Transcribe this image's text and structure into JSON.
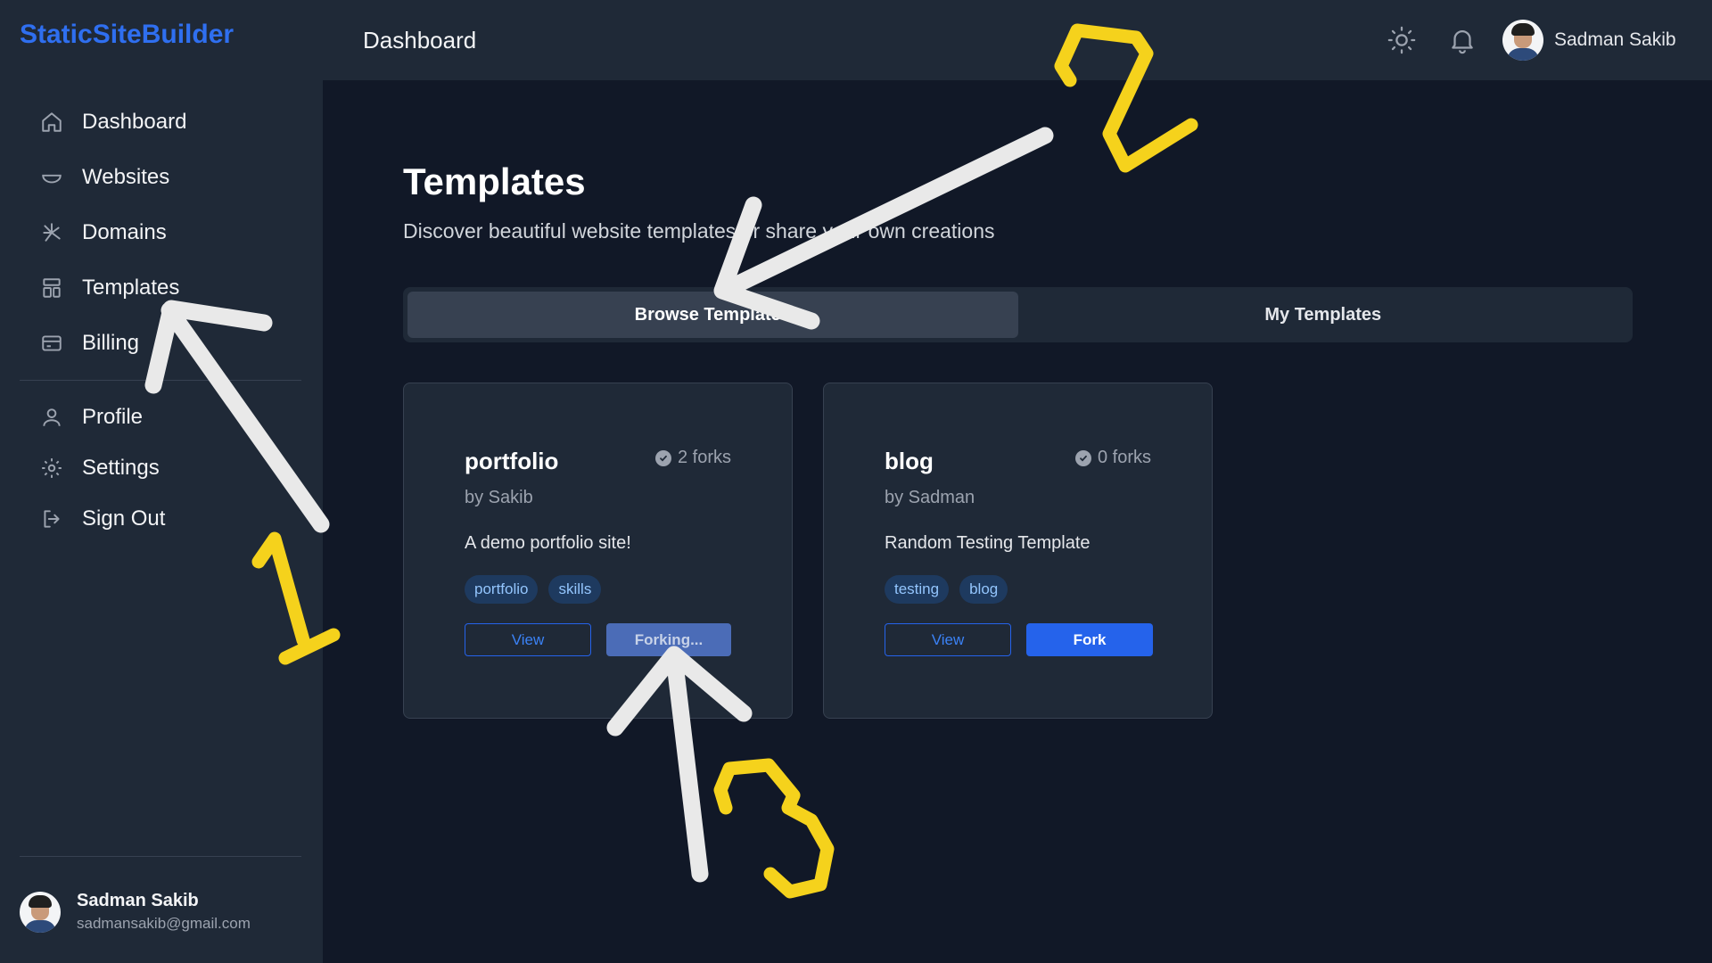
{
  "brand": "StaticSiteBuilder",
  "sidebar": {
    "items": [
      {
        "label": "Dashboard",
        "icon": "home-icon"
      },
      {
        "label": "Websites",
        "icon": "bowl-icon"
      },
      {
        "label": "Domains",
        "icon": "network-icon"
      },
      {
        "label": "Templates",
        "icon": "layout-icon"
      },
      {
        "label": "Billing",
        "icon": "credit-card-icon"
      }
    ],
    "items2": [
      {
        "label": "Profile",
        "icon": "user-icon"
      },
      {
        "label": "Settings",
        "icon": "gear-icon"
      },
      {
        "label": "Sign Out",
        "icon": "sign-out-icon"
      }
    ],
    "user": {
      "name": "Sadman Sakib",
      "email": "sadmansakib@gmail.com"
    }
  },
  "header": {
    "title": "Dashboard",
    "user_name": "Sadman Sakib",
    "icons": [
      "sun-icon",
      "bell-icon"
    ]
  },
  "main": {
    "title": "Templates",
    "subtitle": "Discover beautiful website templates or share your own creations",
    "tabs": [
      {
        "label": "Browse Templates",
        "active": true
      },
      {
        "label": "My Templates",
        "active": false
      }
    ],
    "cards": [
      {
        "title": "portfolio",
        "forks": "2 forks",
        "author": "by Sakib",
        "description": "A demo portfolio site!",
        "tags": [
          "portfolio",
          "skills"
        ],
        "view_label": "View",
        "fork_label": "Forking...",
        "forking": true
      },
      {
        "title": "blog",
        "forks": "0 forks",
        "author": "by Sadman",
        "description": "Random Testing Template",
        "tags": [
          "testing",
          "blog"
        ],
        "view_label": "View",
        "fork_label": "Fork",
        "forking": false
      }
    ]
  },
  "annotations": {
    "labels": [
      "1",
      "2",
      "3"
    ],
    "arrow_color": "#e9e9e9",
    "number_color": "#f5d21c"
  },
  "colors": {
    "accent": "#2563eb",
    "brand": "#2f6ff0",
    "sidebar_bg": "#1f2937",
    "page_bg": "#111827"
  }
}
